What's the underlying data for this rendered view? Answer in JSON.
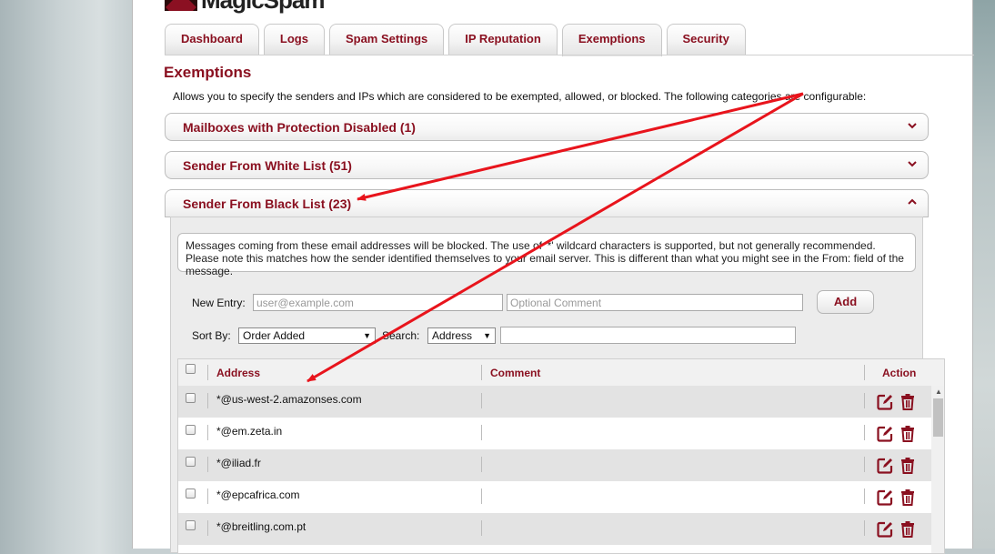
{
  "app": {
    "logo_text": "MagicSpam"
  },
  "tabs": [
    {
      "label": "Dashboard"
    },
    {
      "label": "Logs"
    },
    {
      "label": "Spam Settings"
    },
    {
      "label": "IP Reputation"
    },
    {
      "label": "Exemptions",
      "active": true
    },
    {
      "label": "Security"
    }
  ],
  "page": {
    "title": "Exemptions",
    "description": "Allows you to specify the senders and IPs which are considered to be exempted, allowed, or blocked. The following categories are configurable:"
  },
  "sections": [
    {
      "label": "Mailboxes with Protection Disabled (1)",
      "expanded": false
    },
    {
      "label": "Sender From White List (51)",
      "expanded": false
    },
    {
      "label": "Sender From Black List (23)",
      "expanded": true
    }
  ],
  "blacklist": {
    "note": "Messages coming from these email addresses will be blocked. The use of '*' wildcard characters is supported, but not generally recommended. Please note this matches how the sender identified themselves to your email server. This is different than what you might see in the From: field of the message.",
    "new_entry_label": "New Entry:",
    "entry_placeholder": "user@example.com",
    "comment_placeholder": "Optional Comment",
    "add_label": "Add",
    "sort_label": "Sort By:",
    "sort_value": "Order Added",
    "search_label": "Search:",
    "search_field_value": "Address",
    "search_value": "",
    "columns": [
      "Address",
      "Comment",
      "Action"
    ],
    "rows": [
      {
        "address": "*@us-west-2.amazonses.com",
        "comment": ""
      },
      {
        "address": "*@em.zeta.in",
        "comment": ""
      },
      {
        "address": "*@iliad.fr",
        "comment": ""
      },
      {
        "address": "*@epcafrica.com",
        "comment": ""
      },
      {
        "address": "*@breitling.com.pt",
        "comment": ""
      }
    ]
  },
  "colors": {
    "brand": "#8a1020",
    "annotation_arrow": "#e8141c"
  },
  "icons": {
    "edit": "edit-icon",
    "delete": "trash-icon",
    "expand": "chevron-down-icon",
    "collapse": "chevron-up-icon"
  }
}
